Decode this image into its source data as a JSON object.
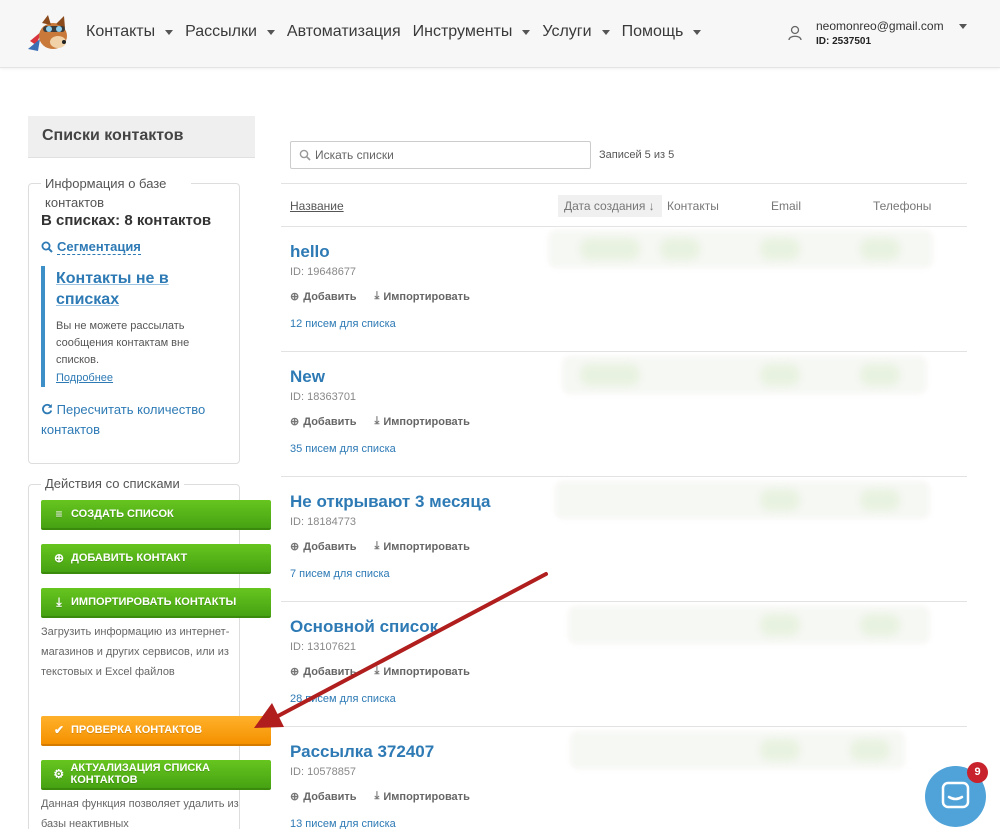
{
  "nav": {
    "items": [
      {
        "label": "Контакты",
        "has_caret": true
      },
      {
        "label": "Рассылки",
        "has_caret": true
      },
      {
        "label": "Автоматизация",
        "has_caret": false
      },
      {
        "label": "Инструменты",
        "has_caret": true
      },
      {
        "label": "Услуги",
        "has_caret": true
      },
      {
        "label": "Помощь",
        "has_caret": true
      }
    ],
    "user": {
      "email": "neomonreo@gmail.com",
      "id": "ID: 2537501"
    }
  },
  "sidebar": {
    "title": "Списки контактов",
    "info": {
      "legend": "Информация о базе контактов",
      "total": "В списках: 8 контактов",
      "segmentation": "Сегментация",
      "note_title": "Контакты не в списках",
      "note_body": "Вы не можете рассылать сообщения контактам вне списков.",
      "note_link": "Подробнее",
      "recount": "Пересчитать количество контактов"
    },
    "actions": {
      "legend": "Действия со списками",
      "create": "СОЗДАТЬ СПИСОК",
      "add_contact": "ДОБАВИТЬ КОНТАКТ",
      "import": "ИМПОРТИРОВАТЬ КОНТАКТЫ",
      "import_desc": "Загрузить информацию из интернет-магазинов и других сервисов, или из текстовых и Excel файлов",
      "check": "ПРОВЕРКА КОНТАКТОВ",
      "actualize": "АКТУАЛИЗАЦИЯ СПИСКА КОНТАКТОВ",
      "actualize_desc": "Данная функция позволяет удалить из базы неактивных"
    }
  },
  "main": {
    "search_placeholder": "Искать списки",
    "records": "Записей 5 из 5",
    "columns": {
      "name": "Название",
      "date": "Дата создания ↓",
      "contacts": "Контакты",
      "email": "Email",
      "phones": "Телефоны"
    },
    "add_label": "Добавить",
    "import_label": "Импортировать",
    "lists": [
      {
        "title": "hello",
        "id": "ID: 19648677",
        "letters": "12 писем для списка"
      },
      {
        "title": "New",
        "id": "ID: 18363701",
        "letters": "35 писем для списка"
      },
      {
        "title": "Не открывают 3 месяца",
        "id": "ID: 18184773",
        "letters": "7 писем для списка"
      },
      {
        "title": "Основной список",
        "id": "ID: 13107621",
        "letters": "28 писем для списка"
      },
      {
        "title": "Рассылка 372407",
        "id": "ID: 10578857",
        "letters": "13 писем для списка"
      }
    ]
  },
  "chat": {
    "badge": "9"
  },
  "colors": {
    "link": "#2d7ab5",
    "green_button": "#56b417",
    "orange_button": "#f9a114",
    "arrow": "#b01e1e",
    "badge": "#c8232c"
  },
  "icons": [
    "logo-fox-mascot",
    "user-icon",
    "search-icon",
    "list-icon",
    "plus-circle-icon",
    "download-icon",
    "check-icon",
    "gears-icon",
    "refresh-icon",
    "chat-icon"
  ]
}
